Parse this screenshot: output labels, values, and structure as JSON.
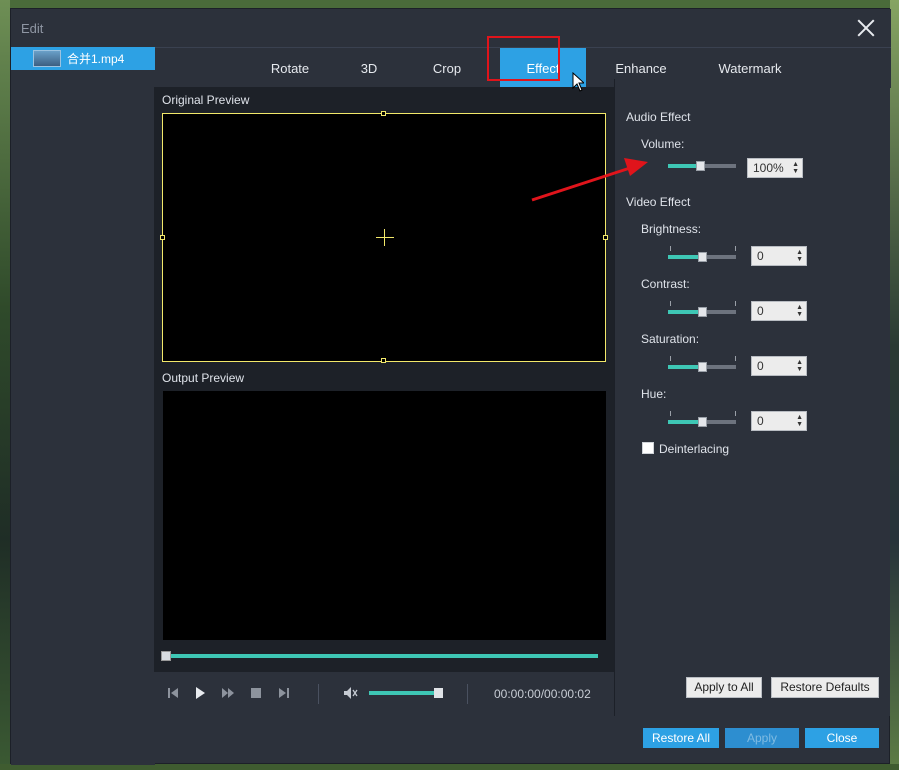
{
  "window": {
    "title": "Edit"
  },
  "file_list": {
    "items": [
      {
        "name": "合并1.mp4"
      }
    ]
  },
  "tabs": [
    {
      "label": "Rotate",
      "active": false
    },
    {
      "label": "3D",
      "active": false
    },
    {
      "label": "Crop",
      "active": false
    },
    {
      "label": "Effect",
      "active": true
    },
    {
      "label": "Enhance",
      "active": false
    },
    {
      "label": "Watermark",
      "active": false
    }
  ],
  "preview": {
    "original_label": "Original Preview",
    "output_label": "Output Preview",
    "progress_percent": 0
  },
  "player": {
    "time": "00:00:00/00:00:02",
    "volume_percent": 95
  },
  "audio_effect": {
    "heading": "Audio Effect",
    "volume_label": "Volume:",
    "volume_value": "100%",
    "volume_slider_percent": 50
  },
  "video_effect": {
    "heading": "Video Effect",
    "brightness_label": "Brightness:",
    "brightness_value": "0",
    "contrast_label": "Contrast:",
    "contrast_value": "0",
    "saturation_label": "Saturation:",
    "saturation_value": "0",
    "hue_label": "Hue:",
    "hue_value": "0",
    "deinterlacing_label": "Deinterlacing",
    "deinterlacing_checked": false
  },
  "actions": {
    "apply_to_all": "Apply to All",
    "restore_defaults": "Restore Defaults",
    "restore_all": "Restore All",
    "apply": "Apply",
    "close": "Close"
  },
  "colors": {
    "accent": "#2da1e4",
    "slider": "#3ec7b5",
    "highlight": "#e0141b"
  }
}
